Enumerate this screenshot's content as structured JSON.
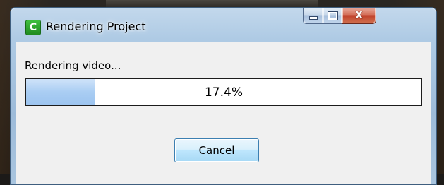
{
  "window": {
    "title": "Rendering Project",
    "icon": "camtasia-app-icon",
    "icon_letter": "C",
    "icon_color": "#2ea82e",
    "minimize_icon": "minimize-icon",
    "maximize_icon": "maximize-icon",
    "close_icon": "close-icon",
    "close_glyph": "X"
  },
  "dialog": {
    "status_label": "Rendering video...",
    "progress": {
      "fraction": 0.174,
      "label": "17.4%",
      "fill_color": "#a9cdf3"
    },
    "cancel_label": "Cancel"
  }
}
